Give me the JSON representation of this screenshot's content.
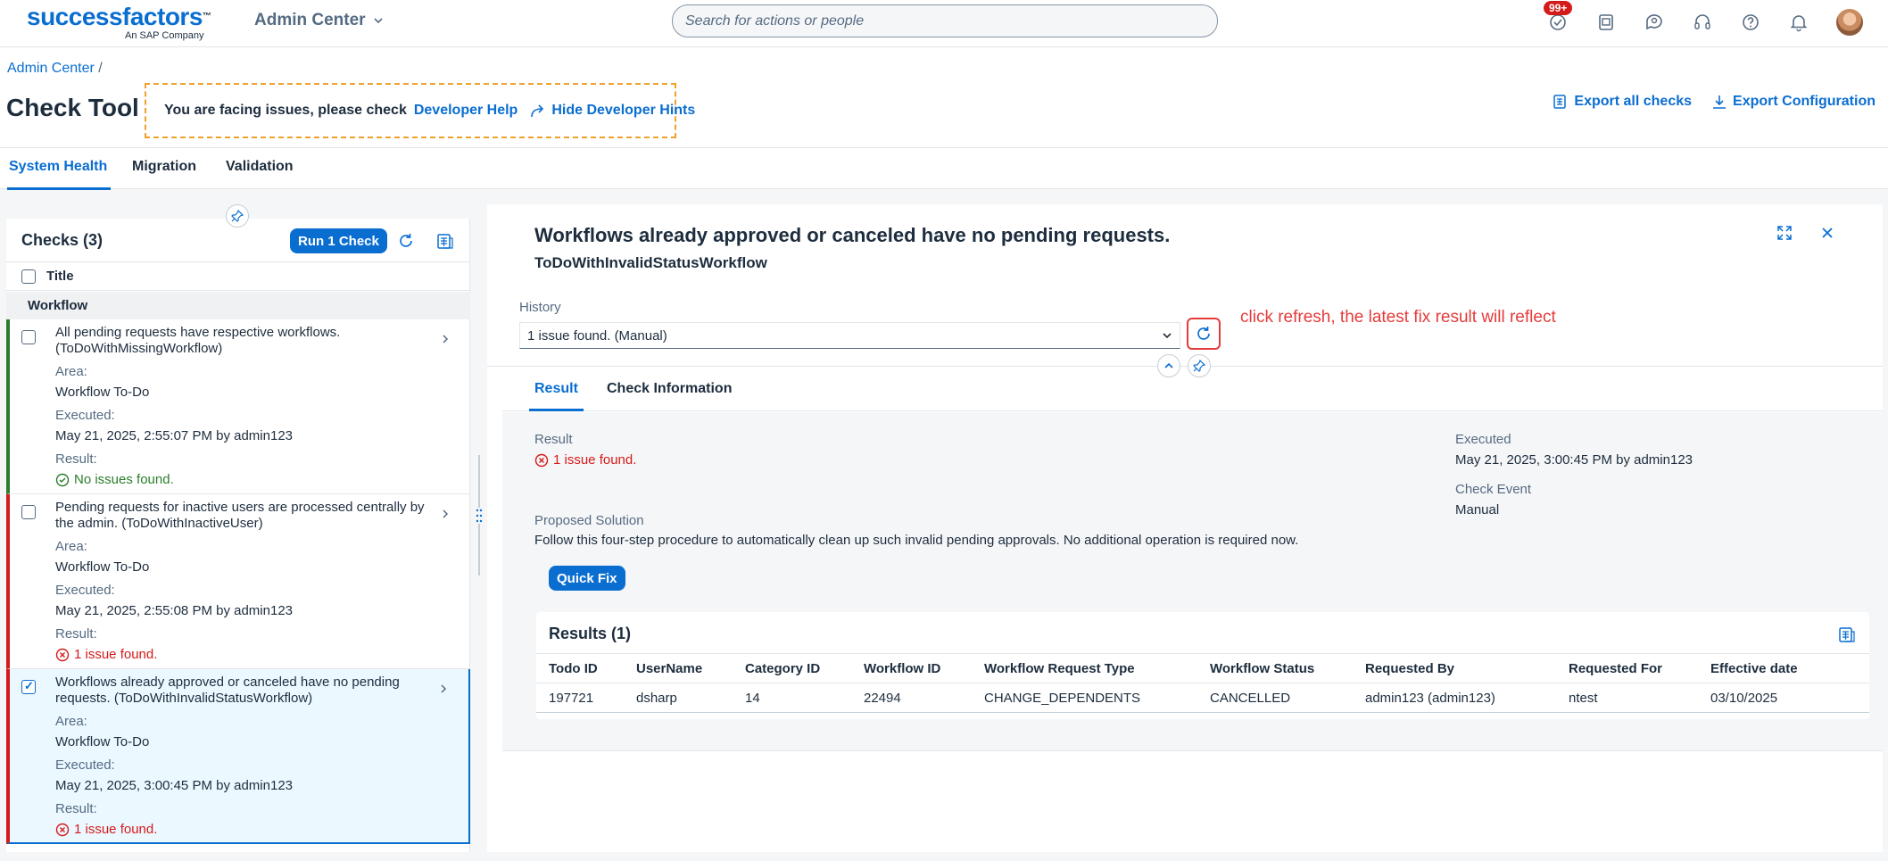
{
  "shell": {
    "logo_text": "successfactors",
    "logo_sub": "An SAP Company",
    "app_menu": "Admin Center",
    "search_placeholder": "Search for actions or people",
    "todo_badge": "99+"
  },
  "header": {
    "breadcrumb": "Admin Center",
    "breadcrumb_sep": "/",
    "title": "Check Tool",
    "hint_text": "You are facing issues, please check",
    "developer_help": "Developer Help",
    "hide_hints": "Hide Developer Hints",
    "export_all": "Export all checks",
    "export_config": "Export Configuration"
  },
  "tabs": [
    "System Health",
    "Migration",
    "Validation"
  ],
  "checks": {
    "title": "Checks (3)",
    "run_button": "Run 1 Check",
    "column_title": "Title",
    "group": "Workflow",
    "area_label": "Area:",
    "executed_label": "Executed:",
    "result_label": "Result:",
    "items": [
      {
        "title": "All pending requests have respective workflows. (ToDoWithMissingWorkflow)",
        "area": "Workflow To-Do",
        "executed": "May 21, 2025, 2:55:07 PM by admin123",
        "result": "No issues found.",
        "status": "ok"
      },
      {
        "title": "Pending requests for inactive users are processed centrally by the admin. (ToDoWithInactiveUser)",
        "area": "Workflow To-Do",
        "executed": "May 21, 2025, 2:55:08 PM by admin123",
        "result": "1 issue found.",
        "status": "error"
      },
      {
        "title": "Workflows already approved or canceled have no pending requests. (ToDoWithInvalidStatusWorkflow)",
        "area": "Workflow To-Do",
        "executed": "May 21, 2025, 3:00:45 PM by admin123",
        "result": "1 issue found.",
        "status": "error"
      }
    ]
  },
  "detail": {
    "title": "Workflows already approved or canceled have no pending requests.",
    "subtitle": "ToDoWithInvalidStatusWorkflow",
    "history_label": "History",
    "history_value": "1 issue found. (Manual)",
    "annotation": "click refresh, the latest fix result will reflect",
    "tabs": [
      "Result",
      "Check Information"
    ],
    "result_label": "Result",
    "result_value": "1 issue found.",
    "executed_label": "Executed",
    "executed_value": "May 21, 2025, 3:00:45 PM by admin123",
    "event_label": "Check Event",
    "event_value": "Manual",
    "solution_label": "Proposed Solution",
    "solution_text": "Follow this four-step procedure to automatically clean up such invalid pending approvals. No additional operation is required now.",
    "quick_fix": "Quick Fix",
    "results_title": "Results (1)",
    "columns": [
      "Todo ID",
      "UserName",
      "Category ID",
      "Workflow ID",
      "Workflow Request Type",
      "Workflow Status",
      "Requested By",
      "Requested For",
      "Effective date"
    ],
    "rows": [
      [
        "197721",
        "dsharp",
        "14",
        "22494",
        "CHANGE_DEPENDENTS",
        "CANCELLED",
        "admin123 (admin123)",
        "ntest",
        "03/10/2025"
      ]
    ]
  },
  "colors": {
    "brand": "#0a6ed1",
    "success": "#2b7d2b",
    "error": "#d51a1a",
    "annotation": "#e53b3b",
    "hint_border": "#f0a02e"
  }
}
